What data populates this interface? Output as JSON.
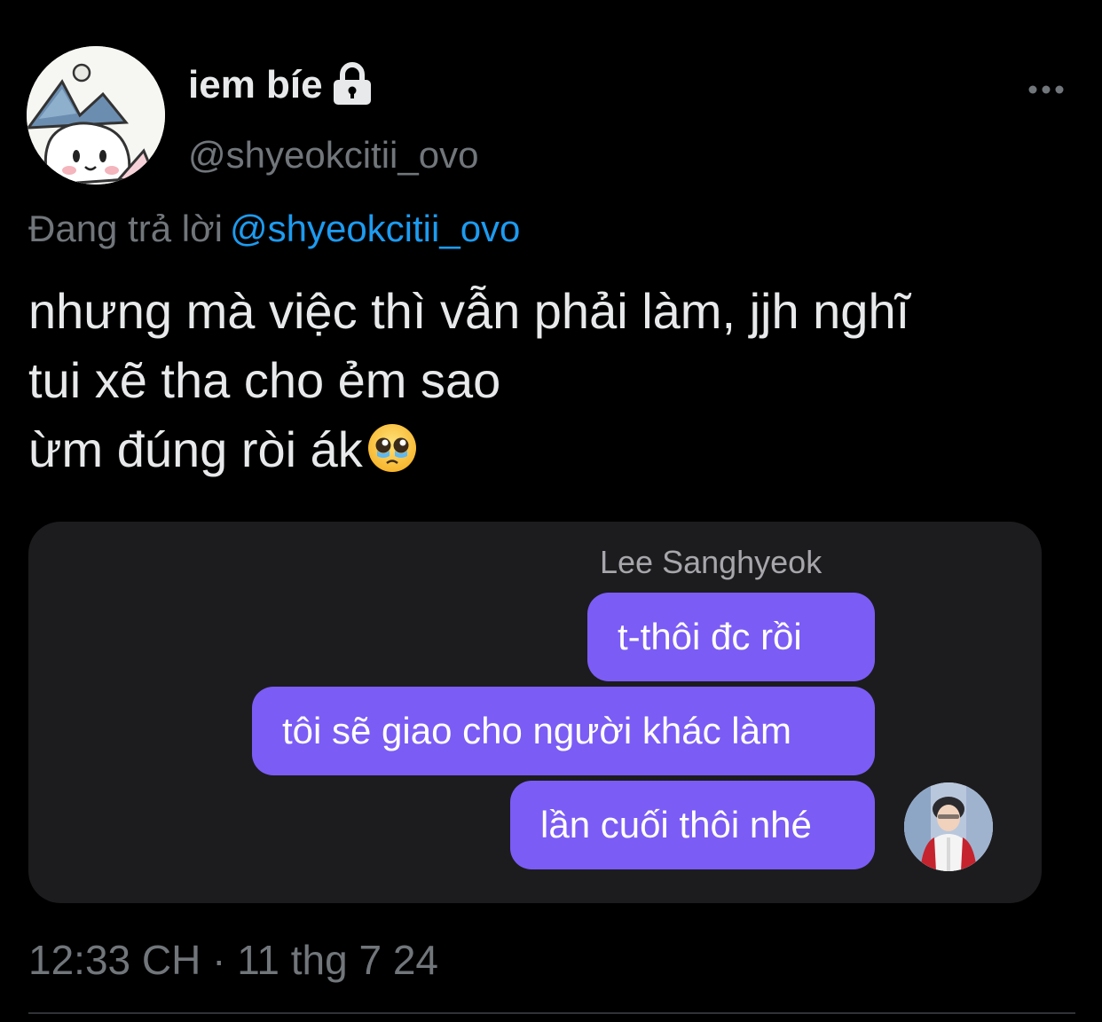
{
  "author": {
    "display_name": "iem bíe",
    "handle": "@shyeokcitii_ovo",
    "protected_icon": "lock-icon",
    "avatar_icon": "cartoon-character-avatar"
  },
  "reply_context": {
    "prefix": "Đang trả lời",
    "mention": "@shyeokcitii_ovo"
  },
  "tweet": {
    "lines": [
      "nhưng mà việc thì vẫn phải làm, jjh nghĩ",
      "tui xẽ tha cho ẻm sao",
      "ừm đúng ròi ák"
    ],
    "trailing_emoji": "pleading-face-tears-icon"
  },
  "media": {
    "sender_name": "Lee Sanghyeok",
    "messages": [
      "t-thôi đc rồi",
      "tôi sẽ giao cho người khác làm",
      "lần cuối thôi nhé"
    ],
    "bubble_color": "#7b5cf5",
    "sender_avatar_icon": "person-photo-avatar"
  },
  "timestamp": "12:33 CH · 11 thg 7 24",
  "more_icon": "more-options-icon",
  "colors": {
    "background": "#000000",
    "primary_text": "#e7e9ea",
    "secondary_text": "#71767b",
    "link": "#1d9bf0",
    "card_background": "#1c1c1e"
  }
}
